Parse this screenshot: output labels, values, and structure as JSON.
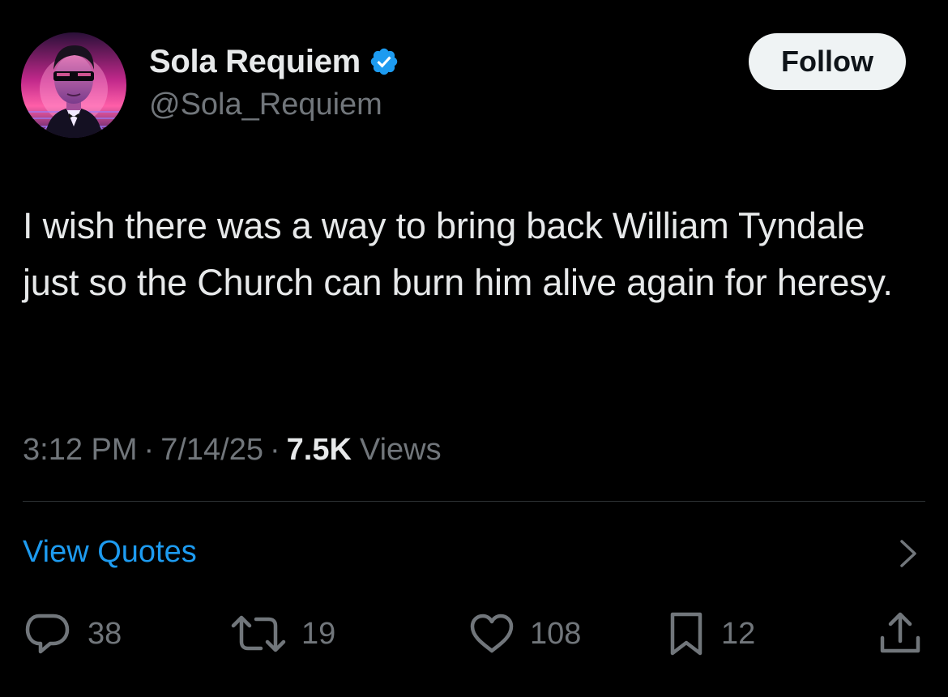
{
  "tweet": {
    "author": {
      "display_name": "Sola Requiem",
      "handle": "@Sola_Requiem",
      "verified": true,
      "avatar_icon": "synthwave-man-with-sunglasses-avatar"
    },
    "follow_label": "Follow",
    "text": "I wish there was a way to bring back William Tyndale just so the Church can burn him alive again for heresy.",
    "time": "3:12 PM",
    "date": "7/14/25",
    "separator": "·",
    "views_count": "7.5K",
    "views_label": "Views",
    "view_quotes_label": "View Quotes",
    "actions": {
      "reply_count": "38",
      "repost_count": "19",
      "like_count": "108",
      "bookmark_count": "12"
    }
  },
  "colors": {
    "background": "#000000",
    "primary_text": "#e7e9ea",
    "secondary_text": "#71767b",
    "accent": "#1d9bf0",
    "follow_button_bg": "#eff3f4",
    "follow_button_text": "#0f1419",
    "divider": "#2f3336"
  },
  "icons": {
    "verified": "verified-badge-icon",
    "chevron": "chevron-right-icon",
    "reply": "reply-bubble-icon",
    "repost": "repost-arrows-icon",
    "like": "heart-icon",
    "bookmark": "bookmark-icon",
    "share": "share-upload-icon"
  }
}
